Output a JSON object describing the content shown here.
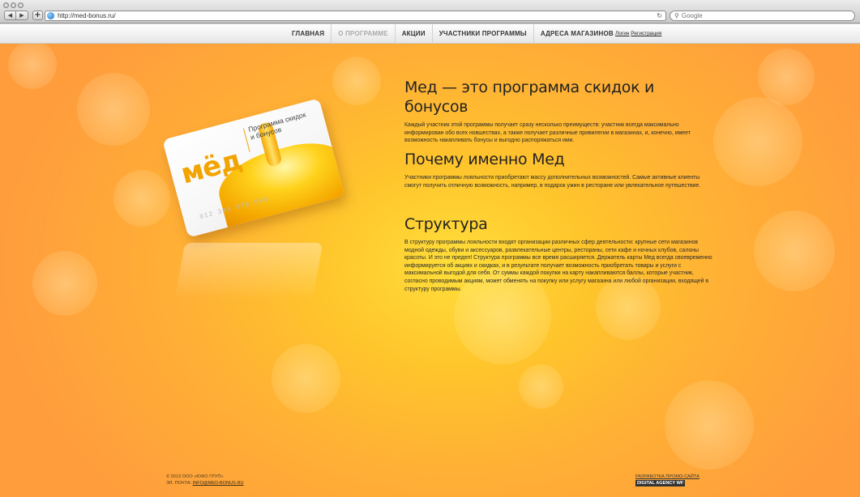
{
  "browser": {
    "address": "http://med-bonus.ru/",
    "search_placeholder": "Google",
    "back_glyph": "◀",
    "forward_glyph": "▶",
    "plus_glyph": "+",
    "reload_glyph": "↻",
    "search_glyph": "⚲"
  },
  "menu": {
    "items": [
      {
        "label": "ГЛАВНАЯ",
        "active": false
      },
      {
        "label": "О ПРОГРАММЕ",
        "active": true
      },
      {
        "label": "АКЦИИ",
        "active": false
      },
      {
        "label": "УЧАСТНИКИ ПРОГРАММЫ",
        "active": false
      },
      {
        "label": "АДРЕСА МАГАЗИНОВ",
        "active": false
      }
    ],
    "login": "Логин",
    "register": "Регистрация"
  },
  "card": {
    "logo": "мёд",
    "tagline": "Программа скидок и бонусов",
    "number": "012 345 678 000"
  },
  "sections": [
    {
      "title": "Мед — это программа скидок и бонусов",
      "text": "Каждый участник этой программы получает сразу несколько преимуществ: участник всегда максимально информирован обо всех новшествах, а также получает различные привилегии в магазинах, и, конечно, имеет возможность накапливать бонусы и выгодно распоряжаться ими."
    },
    {
      "title": "Почему именно Мед",
      "text": "Участники программы лояльности приобретают массу дополнительных возможностей. Самые активные клиенты смогут получить отличную возможность, например, в подарок ужин в ресторане или увлекательное путешествие."
    },
    {
      "title": "Структура",
      "text": "В структуру программы лояльности входят организации различных сфер деятельности: крупные сети магазинов модной одежды, обуви и аксессуаров, развлекательные центры, рестораны, сети кафе и ночных клубов, салоны красоты. И это не предел! Структура программы все время расширяется. Держатель карты Мед всегда своевременно информируется об акциях и скидках, и в результате получает возможность приобретать товары и услуги с максимальной выгодой для себя. От суммы каждой покупки на карту накапливаются баллы, которые участник, согласно проводимым акциям, может обменять на покупку или услугу магазина или любой организации, входящей в структуру программы."
    }
  ],
  "footer": {
    "copyright": "© 2013 ООО «ЮФО ГРУП»",
    "email_label": "ЭЛ. ПОЧТА:",
    "email": "INFO@MED-BONUS.RU",
    "dev_label": "РАЗРАБОТКА ПРОМО-САЙТА",
    "agency": "DIGITAL AGENCY WF"
  }
}
